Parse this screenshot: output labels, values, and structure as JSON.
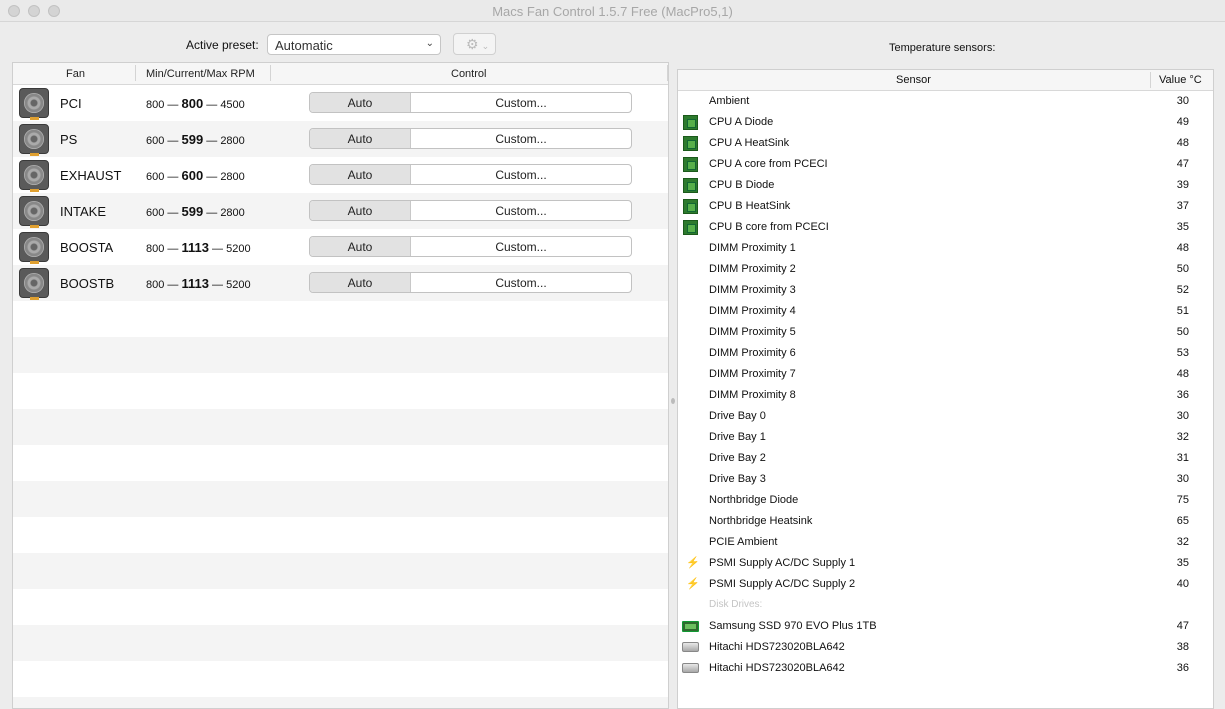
{
  "window": {
    "title": "Macs Fan Control 1.5.7 Free (MacPro5,1)"
  },
  "preset": {
    "label": "Active preset:",
    "value": "Automatic"
  },
  "fan_table": {
    "columns": [
      "Fan",
      "Min/Current/Max RPM",
      "Control"
    ],
    "rows": [
      {
        "name": "PCI",
        "min": "800",
        "current": "800",
        "max": "4500",
        "auto": "Auto",
        "custom": "Custom..."
      },
      {
        "name": "PS",
        "min": "600",
        "current": "599",
        "max": "2800",
        "auto": "Auto",
        "custom": "Custom..."
      },
      {
        "name": "EXHAUST",
        "min": "600",
        "current": "600",
        "max": "2800",
        "auto": "Auto",
        "custom": "Custom..."
      },
      {
        "name": "INTAKE",
        "min": "600",
        "current": "599",
        "max": "2800",
        "auto": "Auto",
        "custom": "Custom..."
      },
      {
        "name": "BOOSTA",
        "min": "800",
        "current": "1113",
        "max": "5200",
        "auto": "Auto",
        "custom": "Custom..."
      },
      {
        "name": "BOOSTB",
        "min": "800",
        "current": "1113",
        "max": "5200",
        "auto": "Auto",
        "custom": "Custom..."
      }
    ]
  },
  "temperature": {
    "label": "Temperature sensors:",
    "columns": [
      "Sensor",
      "Value °C"
    ],
    "rows": [
      {
        "icon": "none",
        "name": "Ambient",
        "value": "30"
      },
      {
        "icon": "cpu-chip-icon",
        "name": "CPU A Diode",
        "value": "49"
      },
      {
        "icon": "cpu-chip-icon",
        "name": "CPU A HeatSink",
        "value": "48"
      },
      {
        "icon": "cpu-chip-icon",
        "name": "CPU A core from PCECI",
        "value": "47"
      },
      {
        "icon": "cpu-chip-icon",
        "name": "CPU B Diode",
        "value": "39"
      },
      {
        "icon": "cpu-chip-icon",
        "name": "CPU B HeatSink",
        "value": "37"
      },
      {
        "icon": "cpu-chip-icon",
        "name": "CPU B core from PCECI",
        "value": "35"
      },
      {
        "icon": "none",
        "name": "DIMM Proximity 1",
        "value": "48"
      },
      {
        "icon": "none",
        "name": "DIMM Proximity 2",
        "value": "50"
      },
      {
        "icon": "none",
        "name": "DIMM Proximity 3",
        "value": "52"
      },
      {
        "icon": "none",
        "name": "DIMM Proximity 4",
        "value": "51"
      },
      {
        "icon": "none",
        "name": "DIMM Proximity 5",
        "value": "50"
      },
      {
        "icon": "none",
        "name": "DIMM Proximity 6",
        "value": "53"
      },
      {
        "icon": "none",
        "name": "DIMM Proximity 7",
        "value": "48"
      },
      {
        "icon": "none",
        "name": "DIMM Proximity 8",
        "value": "36"
      },
      {
        "icon": "none",
        "name": "Drive Bay 0",
        "value": "30"
      },
      {
        "icon": "none",
        "name": "Drive Bay 1",
        "value": "32"
      },
      {
        "icon": "none",
        "name": "Drive Bay 2",
        "value": "31"
      },
      {
        "icon": "none",
        "name": "Drive Bay 3",
        "value": "30"
      },
      {
        "icon": "none",
        "name": "Northbridge Diode",
        "value": "75"
      },
      {
        "icon": "none",
        "name": "Northbridge Heatsink",
        "value": "65"
      },
      {
        "icon": "none",
        "name": "PCIE Ambient",
        "value": "32"
      },
      {
        "icon": "bolt-icon",
        "name": "PSMI Supply AC/DC Supply 1",
        "value": "35"
      },
      {
        "icon": "bolt-icon",
        "name": "PSMI Supply AC/DC Supply 2",
        "value": "40"
      }
    ],
    "disk_header": "Disk Drives:",
    "disks": [
      {
        "icon": "ssd-icon",
        "name": "Samsung SSD 970 EVO Plus 1TB",
        "value": "47"
      },
      {
        "icon": "hdd-icon",
        "name": "Hitachi HDS723020BLA642",
        "value": "38"
      },
      {
        "icon": "hdd-icon",
        "name": "Hitachi HDS723020BLA642",
        "value": "36"
      }
    ]
  }
}
